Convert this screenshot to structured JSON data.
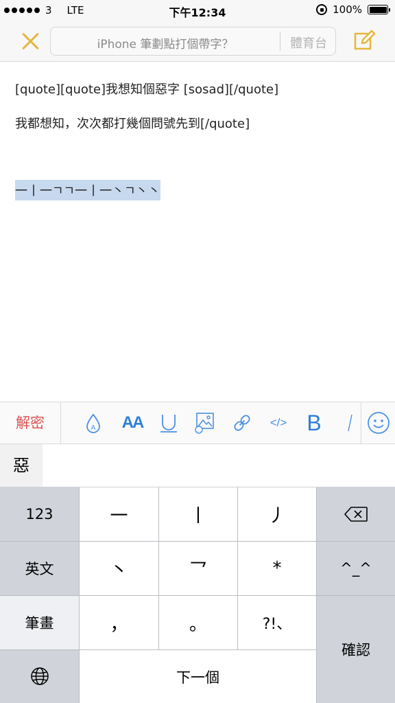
{
  "status_bar": {
    "carrier": "3",
    "network": "LTE",
    "time": "下午12:34",
    "battery": "100%"
  },
  "nav": {
    "title": "iPhone 筆劃點打個帶字？",
    "category": "體育台",
    "accent_color": "#e6b63b",
    "close_icon": "close-icon",
    "compose_icon": "compose-icon"
  },
  "content": {
    "line1": "[quote][quote]我想知個惡字 [sosad][/quote]",
    "line2": "我都想知，次次都打幾個問號先到[/quote]",
    "line3": "一丨一ㄱㄱ一丨一丶ㄱ丶丶"
  },
  "toolbar": {
    "decrypt_label": "解密",
    "decrypt_color": "#e05252",
    "icon_color": "#4a90e2",
    "items": [
      "ink-drop-icon",
      "font-size-icon",
      "underline-icon",
      "image-icon",
      "link-icon",
      "code-icon",
      "bold-icon",
      "italic-icon",
      "emoji-icon"
    ],
    "font_size_label": "AA",
    "code_label": "</>",
    "bold_label": "B"
  },
  "candidate": {
    "char": "惡"
  },
  "keyboard": {
    "side_left": [
      "123",
      "英文",
      "筆畫"
    ],
    "globe_icon": "globe-icon",
    "rows": [
      [
        "一",
        "丨",
        "丿"
      ],
      [
        "丶",
        "乛",
        "*"
      ],
      [
        "，",
        "。",
        "?!、"
      ]
    ],
    "next_label": "下一個",
    "backspace_icon": "backspace-icon",
    "emoticon_label": "^_^",
    "confirm_label": "確認"
  }
}
